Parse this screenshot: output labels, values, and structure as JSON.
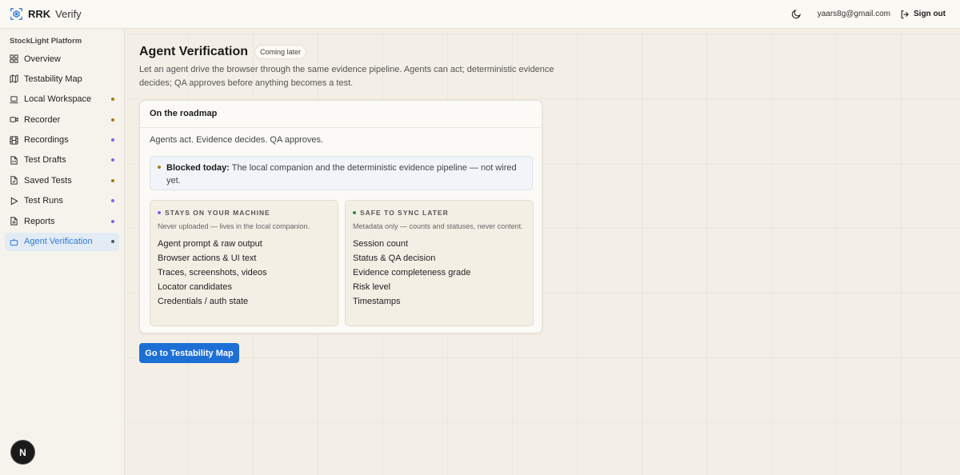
{
  "header": {
    "brand_bold": "RRK",
    "brand_light": "Verify",
    "email": "yaars8g@gmail.com",
    "signout_label": "Sign out"
  },
  "sidebar": {
    "group_label": "StockLight Platform",
    "items": [
      {
        "label": "Overview",
        "icon": "grid-icon",
        "dot": null
      },
      {
        "label": "Testability Map",
        "icon": "map-icon",
        "dot": null
      },
      {
        "label": "Local Workspace",
        "icon": "laptop-icon",
        "dot": "#a67c12"
      },
      {
        "label": "Recorder",
        "icon": "video-icon",
        "dot": "#a67c12"
      },
      {
        "label": "Recordings",
        "icon": "film-icon",
        "dot": "#8b5cf6"
      },
      {
        "label": "Test Drafts",
        "icon": "file-code-icon",
        "dot": "#8b5cf6"
      },
      {
        "label": "Saved Tests",
        "icon": "file-check-icon",
        "dot": "#a67c12"
      },
      {
        "label": "Test Runs",
        "icon": "play-icon",
        "dot": "#8b5cf6"
      },
      {
        "label": "Reports",
        "icon": "report-icon",
        "dot": "#8b5cf6"
      },
      {
        "label": "Agent Verification",
        "icon": "bot-icon",
        "dot": "#555555",
        "active": true
      }
    ]
  },
  "dev_badge": "N",
  "main": {
    "title": "Agent Verification",
    "badge": "Coming later",
    "subtitle": "Let an agent drive the browser through the same evidence pipeline. Agents can act; deterministic evidence decides; QA approves before anything becomes a test.",
    "card": {
      "heading": "On the roadmap",
      "lead": "Agents act. Evidence decides. QA approves.",
      "blocked_label": "Blocked today:",
      "blocked_text": "The local companion and the deterministic evidence pipeline — not wired yet.",
      "left": {
        "title": "STAYS ON YOUR MACHINE",
        "note": "Never uploaded — lives in the local companion.",
        "dot": "#8b5cf6",
        "items": [
          "Agent prompt & raw output",
          "Browser actions & UI text",
          "Traces, screenshots, videos",
          "Locator candidates",
          "Credentials / auth state"
        ]
      },
      "right": {
        "title": "SAFE TO SYNC LATER",
        "note": "Metadata only — counts and statuses, never content.",
        "dot": "#2f8a3e",
        "items": [
          "Session count",
          "Status & QA decision",
          "Evidence completeness grade",
          "Risk level",
          "Timestamps"
        ]
      }
    },
    "cta_label": "Go to Testability Map"
  },
  "colors": {
    "accent": "#1d6fd6",
    "active_nav": "#2f7bd8",
    "amber_dot": "#a67c12",
    "violet_dot": "#8b5cf6",
    "green_dot": "#2f8a3e"
  }
}
